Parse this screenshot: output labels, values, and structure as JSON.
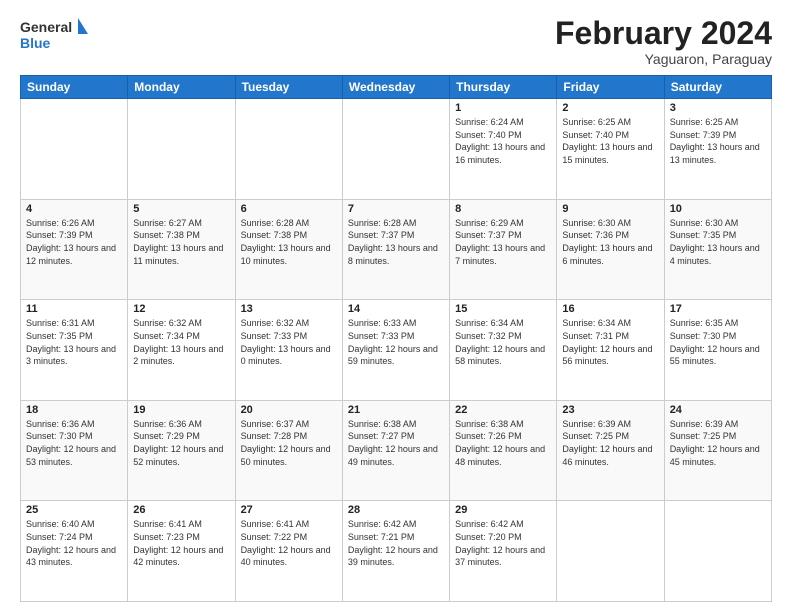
{
  "header": {
    "logo_general": "General",
    "logo_blue": "Blue",
    "month_title": "February 2024",
    "subtitle": "Yaguaron, Paraguay"
  },
  "weekdays": [
    "Sunday",
    "Monday",
    "Tuesday",
    "Wednesday",
    "Thursday",
    "Friday",
    "Saturday"
  ],
  "weeks": [
    [
      {
        "day": "",
        "info": ""
      },
      {
        "day": "",
        "info": ""
      },
      {
        "day": "",
        "info": ""
      },
      {
        "day": "",
        "info": ""
      },
      {
        "day": "1",
        "info": "Sunrise: 6:24 AM\nSunset: 7:40 PM\nDaylight: 13 hours and 16 minutes."
      },
      {
        "day": "2",
        "info": "Sunrise: 6:25 AM\nSunset: 7:40 PM\nDaylight: 13 hours and 15 minutes."
      },
      {
        "day": "3",
        "info": "Sunrise: 6:25 AM\nSunset: 7:39 PM\nDaylight: 13 hours and 13 minutes."
      }
    ],
    [
      {
        "day": "4",
        "info": "Sunrise: 6:26 AM\nSunset: 7:39 PM\nDaylight: 13 hours and 12 minutes."
      },
      {
        "day": "5",
        "info": "Sunrise: 6:27 AM\nSunset: 7:38 PM\nDaylight: 13 hours and 11 minutes."
      },
      {
        "day": "6",
        "info": "Sunrise: 6:28 AM\nSunset: 7:38 PM\nDaylight: 13 hours and 10 minutes."
      },
      {
        "day": "7",
        "info": "Sunrise: 6:28 AM\nSunset: 7:37 PM\nDaylight: 13 hours and 8 minutes."
      },
      {
        "day": "8",
        "info": "Sunrise: 6:29 AM\nSunset: 7:37 PM\nDaylight: 13 hours and 7 minutes."
      },
      {
        "day": "9",
        "info": "Sunrise: 6:30 AM\nSunset: 7:36 PM\nDaylight: 13 hours and 6 minutes."
      },
      {
        "day": "10",
        "info": "Sunrise: 6:30 AM\nSunset: 7:35 PM\nDaylight: 13 hours and 4 minutes."
      }
    ],
    [
      {
        "day": "11",
        "info": "Sunrise: 6:31 AM\nSunset: 7:35 PM\nDaylight: 13 hours and 3 minutes."
      },
      {
        "day": "12",
        "info": "Sunrise: 6:32 AM\nSunset: 7:34 PM\nDaylight: 13 hours and 2 minutes."
      },
      {
        "day": "13",
        "info": "Sunrise: 6:32 AM\nSunset: 7:33 PM\nDaylight: 13 hours and 0 minutes."
      },
      {
        "day": "14",
        "info": "Sunrise: 6:33 AM\nSunset: 7:33 PM\nDaylight: 12 hours and 59 minutes."
      },
      {
        "day": "15",
        "info": "Sunrise: 6:34 AM\nSunset: 7:32 PM\nDaylight: 12 hours and 58 minutes."
      },
      {
        "day": "16",
        "info": "Sunrise: 6:34 AM\nSunset: 7:31 PM\nDaylight: 12 hours and 56 minutes."
      },
      {
        "day": "17",
        "info": "Sunrise: 6:35 AM\nSunset: 7:30 PM\nDaylight: 12 hours and 55 minutes."
      }
    ],
    [
      {
        "day": "18",
        "info": "Sunrise: 6:36 AM\nSunset: 7:30 PM\nDaylight: 12 hours and 53 minutes."
      },
      {
        "day": "19",
        "info": "Sunrise: 6:36 AM\nSunset: 7:29 PM\nDaylight: 12 hours and 52 minutes."
      },
      {
        "day": "20",
        "info": "Sunrise: 6:37 AM\nSunset: 7:28 PM\nDaylight: 12 hours and 50 minutes."
      },
      {
        "day": "21",
        "info": "Sunrise: 6:38 AM\nSunset: 7:27 PM\nDaylight: 12 hours and 49 minutes."
      },
      {
        "day": "22",
        "info": "Sunrise: 6:38 AM\nSunset: 7:26 PM\nDaylight: 12 hours and 48 minutes."
      },
      {
        "day": "23",
        "info": "Sunrise: 6:39 AM\nSunset: 7:25 PM\nDaylight: 12 hours and 46 minutes."
      },
      {
        "day": "24",
        "info": "Sunrise: 6:39 AM\nSunset: 7:25 PM\nDaylight: 12 hours and 45 minutes."
      }
    ],
    [
      {
        "day": "25",
        "info": "Sunrise: 6:40 AM\nSunset: 7:24 PM\nDaylight: 12 hours and 43 minutes."
      },
      {
        "day": "26",
        "info": "Sunrise: 6:41 AM\nSunset: 7:23 PM\nDaylight: 12 hours and 42 minutes."
      },
      {
        "day": "27",
        "info": "Sunrise: 6:41 AM\nSunset: 7:22 PM\nDaylight: 12 hours and 40 minutes."
      },
      {
        "day": "28",
        "info": "Sunrise: 6:42 AM\nSunset: 7:21 PM\nDaylight: 12 hours and 39 minutes."
      },
      {
        "day": "29",
        "info": "Sunrise: 6:42 AM\nSunset: 7:20 PM\nDaylight: 12 hours and 37 minutes."
      },
      {
        "day": "",
        "info": ""
      },
      {
        "day": "",
        "info": ""
      }
    ]
  ]
}
